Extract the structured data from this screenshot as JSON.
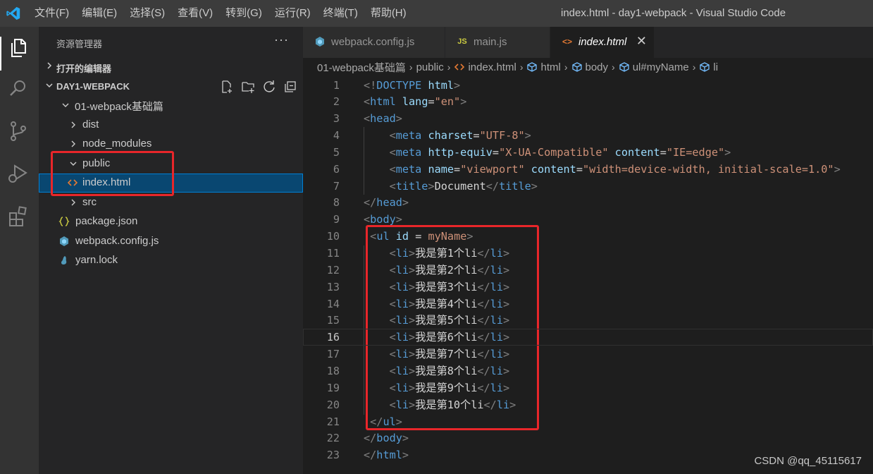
{
  "window": {
    "title": "index.html - day1-webpack - Visual Studio Code",
    "menu": [
      "文件(F)",
      "编辑(E)",
      "选择(S)",
      "查看(V)",
      "转到(G)",
      "运行(R)",
      "终端(T)",
      "帮助(H)"
    ]
  },
  "sidebar": {
    "title": "资源管理器",
    "more": "···",
    "open_editors": "打开的编辑器",
    "workspace": "DAY1-WEBPACK",
    "tree": [
      {
        "label": "01-webpack基础篇",
        "kind": "folder-open",
        "depth": 1
      },
      {
        "label": "dist",
        "kind": "folder",
        "depth": 2
      },
      {
        "label": "node_modules",
        "kind": "folder",
        "depth": 2
      },
      {
        "label": "public",
        "kind": "folder-open",
        "depth": 2
      },
      {
        "label": "index.html",
        "kind": "html",
        "depth": 3,
        "selected": true
      },
      {
        "label": "src",
        "kind": "folder",
        "depth": 2
      },
      {
        "label": "package.json",
        "kind": "json",
        "depth": 2
      },
      {
        "label": "webpack.config.js",
        "kind": "webpack",
        "depth": 2
      },
      {
        "label": "yarn.lock",
        "kind": "yarn",
        "depth": 2
      }
    ]
  },
  "tabs": [
    {
      "label": "webpack.config.js",
      "icon": "webpack-icon",
      "active": false
    },
    {
      "label": "main.js",
      "icon": "js-icon",
      "active": false
    },
    {
      "label": "index.html",
      "icon": "html-icon",
      "active": true,
      "close": "✕"
    }
  ],
  "tab_icons": {
    "js": "JS",
    "html": "<>"
  },
  "breadcrumb": [
    "01-webpack基础篇",
    "public",
    "index.html",
    "html",
    "body",
    "ul#myName",
    "li"
  ],
  "editor": {
    "current_line": 16,
    "lines": [
      [
        [
          "p",
          "<!"
        ],
        [
          "tag",
          "DOCTYPE"
        ],
        [
          "txt",
          " "
        ],
        [
          "attr",
          "html"
        ],
        [
          "p",
          ">"
        ]
      ],
      [
        [
          "p",
          "<"
        ],
        [
          "tag",
          "html"
        ],
        [
          "txt",
          " "
        ],
        [
          "attr",
          "lang"
        ],
        [
          "txt",
          "="
        ],
        [
          "str",
          "\"en\""
        ],
        [
          "p",
          ">"
        ]
      ],
      [
        [
          "p",
          "<"
        ],
        [
          "tag",
          "head"
        ],
        [
          "p",
          ">"
        ]
      ],
      [
        [
          "txt",
          "    "
        ],
        [
          "p",
          "<"
        ],
        [
          "tag",
          "meta"
        ],
        [
          "txt",
          " "
        ],
        [
          "attr",
          "charset"
        ],
        [
          "txt",
          "="
        ],
        [
          "str",
          "\"UTF-8\""
        ],
        [
          "p",
          ">"
        ]
      ],
      [
        [
          "txt",
          "    "
        ],
        [
          "p",
          "<"
        ],
        [
          "tag",
          "meta"
        ],
        [
          "txt",
          " "
        ],
        [
          "attr",
          "http-equiv"
        ],
        [
          "txt",
          "="
        ],
        [
          "str",
          "\"X-UA-Compatible\""
        ],
        [
          "txt",
          " "
        ],
        [
          "attr",
          "content"
        ],
        [
          "txt",
          "="
        ],
        [
          "str",
          "\"IE=edge\""
        ],
        [
          "p",
          ">"
        ]
      ],
      [
        [
          "txt",
          "    "
        ],
        [
          "p",
          "<"
        ],
        [
          "tag",
          "meta"
        ],
        [
          "txt",
          " "
        ],
        [
          "attr",
          "name"
        ],
        [
          "txt",
          "="
        ],
        [
          "str",
          "\"viewport\""
        ],
        [
          "txt",
          " "
        ],
        [
          "attr",
          "content"
        ],
        [
          "txt",
          "="
        ],
        [
          "str",
          "\"width=device-width, initial-scale=1.0\""
        ],
        [
          "p",
          ">"
        ]
      ],
      [
        [
          "txt",
          "    "
        ],
        [
          "p",
          "<"
        ],
        [
          "tag",
          "title"
        ],
        [
          "p",
          ">"
        ],
        [
          "txt",
          "Document"
        ],
        [
          "p",
          "</"
        ],
        [
          "tag",
          "title"
        ],
        [
          "p",
          ">"
        ]
      ],
      [
        [
          "p",
          "</"
        ],
        [
          "tag",
          "head"
        ],
        [
          "p",
          ">"
        ]
      ],
      [
        [
          "p",
          "<"
        ],
        [
          "tag",
          "body"
        ],
        [
          "p",
          ">"
        ]
      ],
      [
        [
          "txt",
          " "
        ],
        [
          "p",
          "<"
        ],
        [
          "tag",
          "ul"
        ],
        [
          "txt",
          " "
        ],
        [
          "attr",
          "id"
        ],
        [
          "txt",
          " = "
        ],
        [
          "str",
          "myName"
        ],
        [
          "p",
          ">"
        ]
      ],
      [
        [
          "txt",
          "    "
        ],
        [
          "p",
          "<"
        ],
        [
          "tag",
          "li"
        ],
        [
          "p",
          ">"
        ],
        [
          "txt",
          "我是第1个li"
        ],
        [
          "p",
          "</"
        ],
        [
          "tag",
          "li"
        ],
        [
          "p",
          ">"
        ]
      ],
      [
        [
          "txt",
          "    "
        ],
        [
          "p",
          "<"
        ],
        [
          "tag",
          "li"
        ],
        [
          "p",
          ">"
        ],
        [
          "txt",
          "我是第2个li"
        ],
        [
          "p",
          "</"
        ],
        [
          "tag",
          "li"
        ],
        [
          "p",
          ">"
        ]
      ],
      [
        [
          "txt",
          "    "
        ],
        [
          "p",
          "<"
        ],
        [
          "tag",
          "li"
        ],
        [
          "p",
          ">"
        ],
        [
          "txt",
          "我是第3个li"
        ],
        [
          "p",
          "</"
        ],
        [
          "tag",
          "li"
        ],
        [
          "p",
          ">"
        ]
      ],
      [
        [
          "txt",
          "    "
        ],
        [
          "p",
          "<"
        ],
        [
          "tag",
          "li"
        ],
        [
          "p",
          ">"
        ],
        [
          "txt",
          "我是第4个li"
        ],
        [
          "p",
          "</"
        ],
        [
          "tag",
          "li"
        ],
        [
          "p",
          ">"
        ]
      ],
      [
        [
          "txt",
          "    "
        ],
        [
          "p",
          "<"
        ],
        [
          "tag",
          "li"
        ],
        [
          "p",
          ">"
        ],
        [
          "txt",
          "我是第5个li"
        ],
        [
          "p",
          "</"
        ],
        [
          "tag",
          "li"
        ],
        [
          "p",
          ">"
        ]
      ],
      [
        [
          "txt",
          "    "
        ],
        [
          "p",
          "<"
        ],
        [
          "tag",
          "li"
        ],
        [
          "p",
          ">"
        ],
        [
          "txt",
          "我是第6个li"
        ],
        [
          "p",
          "</"
        ],
        [
          "tag",
          "li"
        ],
        [
          "p",
          ">"
        ]
      ],
      [
        [
          "txt",
          "    "
        ],
        [
          "p",
          "<"
        ],
        [
          "tag",
          "li"
        ],
        [
          "p",
          ">"
        ],
        [
          "txt",
          "我是第7个li"
        ],
        [
          "p",
          "</"
        ],
        [
          "tag",
          "li"
        ],
        [
          "p",
          ">"
        ]
      ],
      [
        [
          "txt",
          "    "
        ],
        [
          "p",
          "<"
        ],
        [
          "tag",
          "li"
        ],
        [
          "p",
          ">"
        ],
        [
          "txt",
          "我是第8个li"
        ],
        [
          "p",
          "</"
        ],
        [
          "tag",
          "li"
        ],
        [
          "p",
          ">"
        ]
      ],
      [
        [
          "txt",
          "    "
        ],
        [
          "p",
          "<"
        ],
        [
          "tag",
          "li"
        ],
        [
          "p",
          ">"
        ],
        [
          "txt",
          "我是第9个li"
        ],
        [
          "p",
          "</"
        ],
        [
          "tag",
          "li"
        ],
        [
          "p",
          ">"
        ]
      ],
      [
        [
          "txt",
          "    "
        ],
        [
          "p",
          "<"
        ],
        [
          "tag",
          "li"
        ],
        [
          "p",
          ">"
        ],
        [
          "txt",
          "我是第10个li"
        ],
        [
          "p",
          "</"
        ],
        [
          "tag",
          "li"
        ],
        [
          "p",
          ">"
        ]
      ],
      [
        [
          "txt",
          " "
        ],
        [
          "p",
          "</"
        ],
        [
          "tag",
          "ul"
        ],
        [
          "p",
          ">"
        ]
      ],
      [
        [
          "p",
          "</"
        ],
        [
          "tag",
          "body"
        ],
        [
          "p",
          ">"
        ]
      ],
      [
        [
          "p",
          "</"
        ],
        [
          "tag",
          "html"
        ],
        [
          "p",
          ">"
        ]
      ]
    ]
  },
  "watermark": "CSDN @qq_45115617",
  "colors": {
    "highlight_box": "#e8262a",
    "selection": "#094771",
    "accent": "#007acc"
  }
}
